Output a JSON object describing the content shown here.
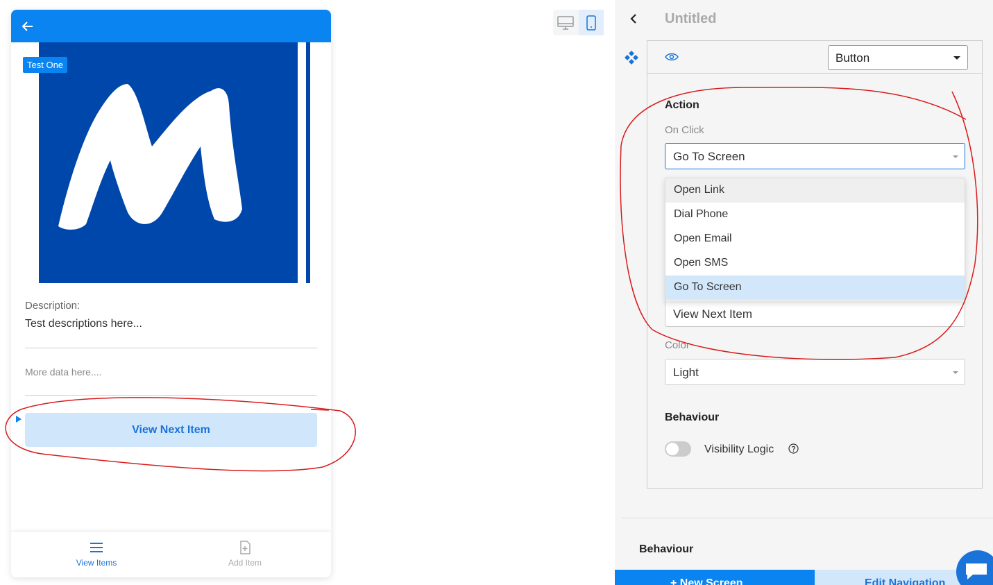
{
  "preview": {
    "tag": "Test One",
    "description_label": "Description:",
    "description_text": "Test descriptions here...",
    "more_data": "More data here....",
    "button_label": "View Next Item",
    "nav": [
      {
        "label": "View Items",
        "icon": "list-icon"
      },
      {
        "label": "Add Item",
        "icon": "add-document-icon"
      }
    ]
  },
  "panel": {
    "title": "Untitled",
    "component_type": "Button",
    "action_heading": "Action",
    "on_click_label": "On Click",
    "on_click_value": "Go To Screen",
    "options": [
      "Open Link",
      "Dial Phone",
      "Open Email",
      "Open SMS",
      "Go To Screen"
    ],
    "hovered_option": "Open Link",
    "text_value": "View Next Item",
    "color_label": "Color",
    "color_value": "Light",
    "behaviour_heading": "Behaviour",
    "visibility_label": "Visibility Logic",
    "behaviour_heading_2": "Behaviour",
    "bottom_buttons": [
      "+ New Screen",
      "Edit Navigation"
    ]
  },
  "colors": {
    "accent": "#0a84f0",
    "annotation": "#d81b1b",
    "hero": "#0047ab"
  }
}
